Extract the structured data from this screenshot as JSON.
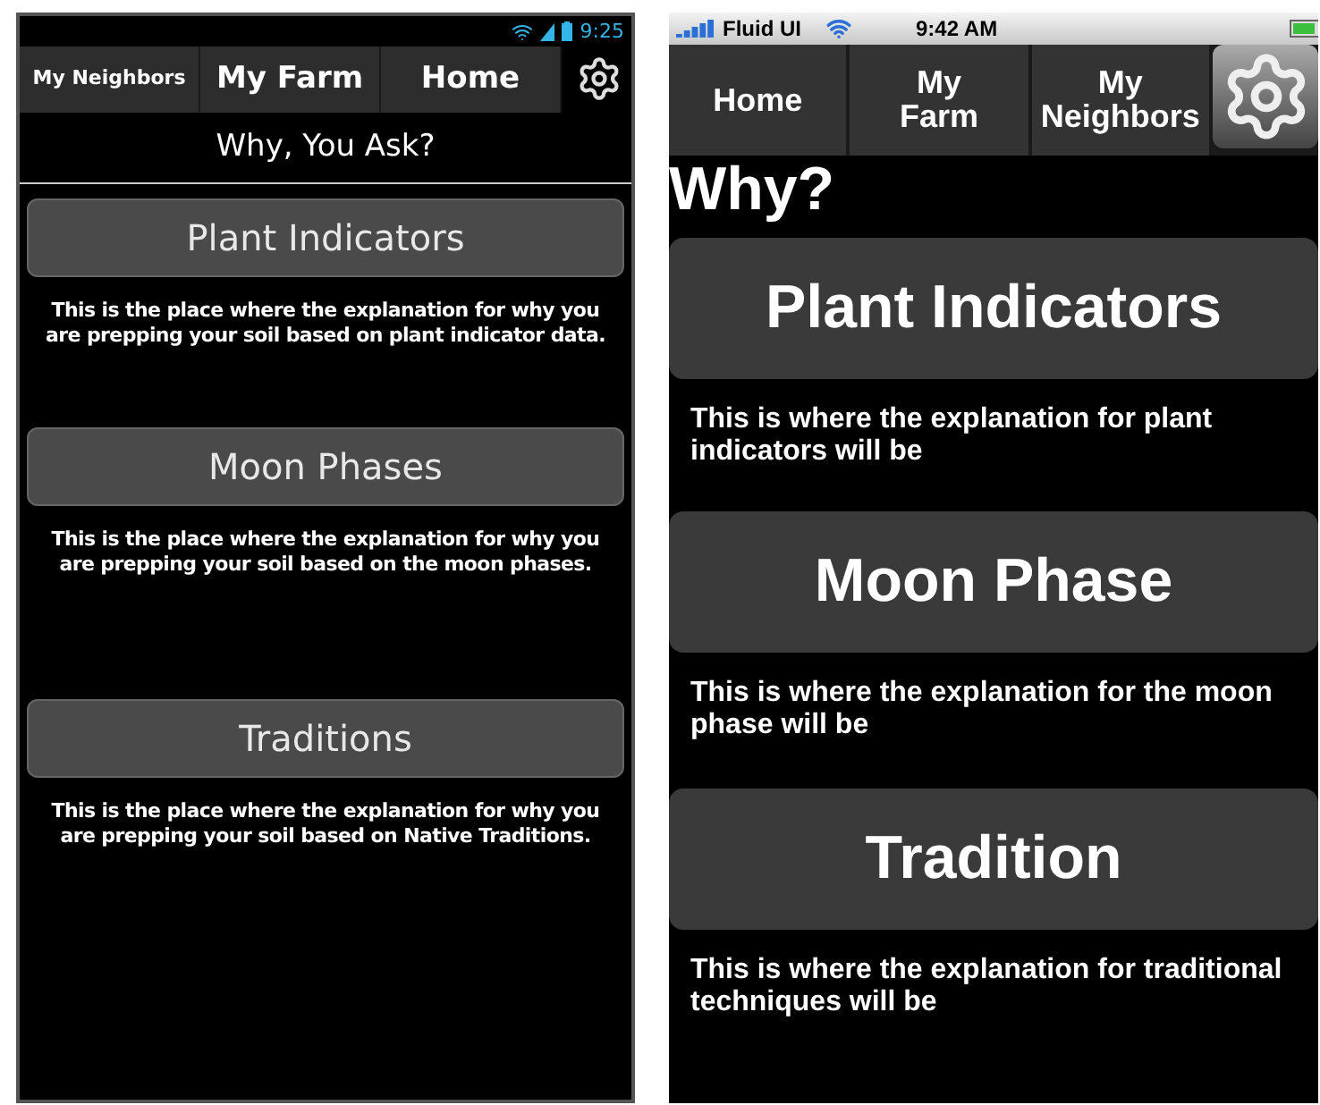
{
  "android": {
    "status_bar": {
      "time": "9:25"
    },
    "tabs": [
      {
        "label": "My Neighbors"
      },
      {
        "label": "My Farm"
      },
      {
        "label": "Home"
      }
    ],
    "title": "Why, You Ask?",
    "sections": [
      {
        "heading": "Plant Indicators",
        "text": "This is the place where the explanation for why you are prepping your soil based on plant indicator data."
      },
      {
        "heading": "Moon Phases",
        "text": "This is the place where the explanation for why you are prepping your soil based on the moon phases."
      },
      {
        "heading": "Traditions",
        "text": "This is the place where the explanation for why you are prepping your soil based on Native Traditions."
      }
    ]
  },
  "ios": {
    "status_bar": {
      "carrier": "Fluid UI",
      "time": "9:42 AM"
    },
    "tabs": [
      {
        "label": "Home"
      },
      {
        "label": "My Farm"
      },
      {
        "label": "My Neighbors"
      }
    ],
    "title": "Why?",
    "sections": [
      {
        "heading": "Plant Indicators",
        "text": "This is where the explanation for plant indicators will be"
      },
      {
        "heading": "Moon Phase",
        "text": "This is where the explanation for the moon phase will be"
      },
      {
        "heading": "Tradition",
        "text": "This is where the explanation for traditional techniques will be"
      }
    ]
  }
}
